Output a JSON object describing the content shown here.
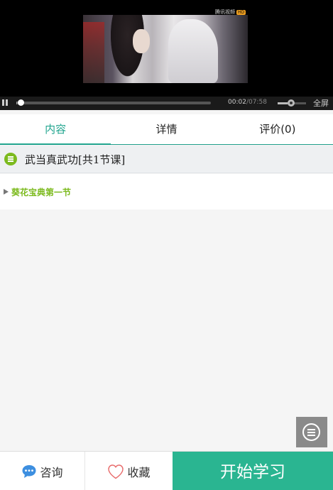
{
  "player": {
    "watermark": "腾讯视频",
    "watermark_badge": "HD",
    "time_current": "00:02",
    "time_separator": "/",
    "time_total": "07:58",
    "progress": 0.004,
    "volume": 0.35,
    "fullscreen_label": "全屏"
  },
  "tabs": [
    {
      "label": "内容",
      "active": true
    },
    {
      "label": "详情",
      "active": false
    },
    {
      "label": "评价(0)",
      "active": false
    }
  ],
  "section": {
    "title": "武当真武功[共1节课]"
  },
  "lessons": [
    {
      "label": "葵花宝典第一节"
    }
  ],
  "bottom_bar": {
    "consult_label": "咨询",
    "favorite_label": "收藏",
    "start_label": "开始学习"
  },
  "colors": {
    "accent": "#22a58f",
    "start_button": "#2ab591",
    "lesson_green": "#7cba1e",
    "consult_icon": "#3d8fe0",
    "favorite_icon": "#e86b6b"
  },
  "icons": {
    "consult": "chat-bubble-icon",
    "favorite": "heart-icon",
    "section": "list-circle-icon",
    "float_menu": "menu-circle-icon"
  }
}
